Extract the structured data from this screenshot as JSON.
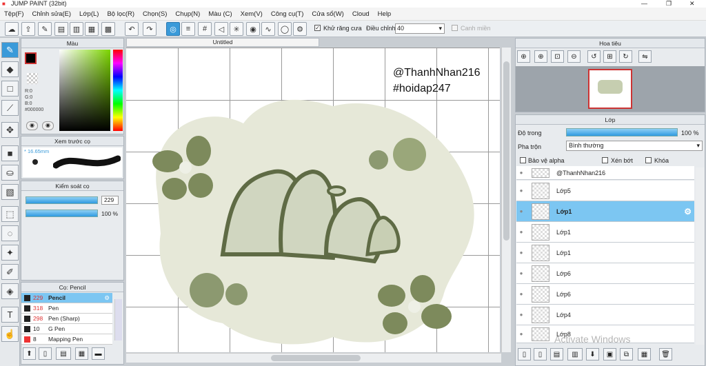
{
  "window": {
    "title": "JUMP PAINT (32bit)"
  },
  "menu": [
    "Tệp(F)",
    "Chỉnh sửa(E)",
    "Lớp(L)",
    "Bộ lọc(R)",
    "Chọn(S)",
    "Chụp(N)",
    "Màu (C)",
    "Xem(V)",
    "Công cụ(T)",
    "Cửa sổ(W)",
    "Cloud",
    "Help"
  ],
  "toolbar": {
    "antialias_label": "Khử răng cưa",
    "adjust_label": "Điều chỉnh",
    "adjust_value": "40",
    "snap_label": "Canh miền"
  },
  "color_panel": {
    "title": "Màu",
    "r": "R:0",
    "g": "G:0",
    "b": "B:0",
    "hex": "#000000"
  },
  "preview_panel": {
    "title": "Xem trước cọ",
    "size": "16.65mm"
  },
  "brush_control": {
    "title": "Kiểm soát cọ",
    "size": "229",
    "opacity": "100 %"
  },
  "brush_list": {
    "title": "Cọ: Pencil",
    "items": [
      {
        "size": "229",
        "name": "Pencil",
        "selected": true
      },
      {
        "size": "318",
        "name": "Pen",
        "selected": false
      },
      {
        "size": "298",
        "name": "Pen (Sharp)",
        "selected": false
      },
      {
        "size": "10",
        "name": "G Pen",
        "selected": false
      },
      {
        "size": "8",
        "name": "Mapping Pen",
        "selected": false
      }
    ]
  },
  "document": {
    "tab": "Untitled",
    "watermark_1": "@ThanhNhan216",
    "watermark_2": "#hoidap247"
  },
  "navigator": {
    "title": "Hoa tiêu"
  },
  "layers_panel": {
    "title": "Lớp",
    "opacity_label": "Độ trong",
    "opacity_value": "100 %",
    "blend_label": "Pha trộn",
    "blend_value": "Bình thường",
    "protect_alpha": "Bảo vệ alpha",
    "clipping": "Xén bớt",
    "lock": "Khóa",
    "layers": [
      {
        "name": "@ThanhNhan216",
        "selected": false
      },
      {
        "name": "Lớp5",
        "selected": false
      },
      {
        "name": "Lớp1",
        "selected": true
      },
      {
        "name": "Lớp1",
        "selected": false
      },
      {
        "name": "Lớp1",
        "selected": false
      },
      {
        "name": "Lớp6",
        "selected": false
      },
      {
        "name": "Lớp6",
        "selected": false
      },
      {
        "name": "Lớp4",
        "selected": false
      },
      {
        "name": "Lớp8",
        "selected": false
      }
    ]
  },
  "overlay": {
    "activate": "Activate Windows"
  },
  "colors": {
    "accent": "#3a9ad9",
    "canvas_blob": "#e8eadd",
    "flower": "#7d8a5c"
  }
}
